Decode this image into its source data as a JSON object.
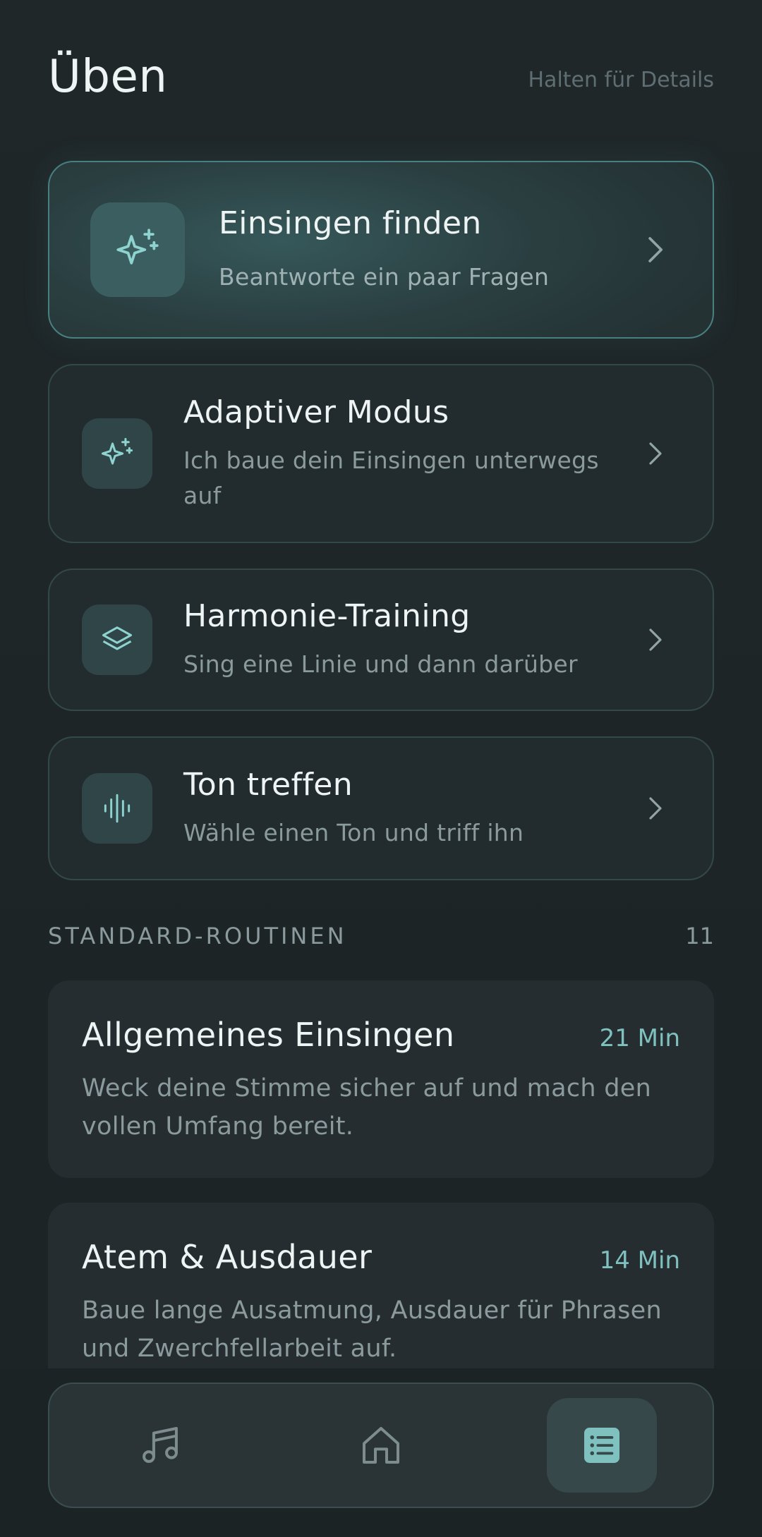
{
  "header": {
    "title": "Üben",
    "hint": "Halten für Details"
  },
  "cards": [
    {
      "title": "Einsingen finden",
      "subtitle": "Beantworte ein paar Fragen",
      "icon": "sparkles-icon",
      "featured": true
    },
    {
      "title": "Adaptiver Modus",
      "subtitle": "Ich baue dein Einsingen unterwegs auf",
      "icon": "sparkles-icon"
    },
    {
      "title": "Harmonie-Training",
      "subtitle": "Sing eine Linie und dann darüber",
      "icon": "layers-icon"
    },
    {
      "title": "Ton treffen",
      "subtitle": "Wähle einen Ton und triff ihn",
      "icon": "waveform-icon"
    }
  ],
  "routines_section": {
    "label": "STANDARD-ROUTINEN",
    "count": "11"
  },
  "routines": [
    {
      "title": "Allgemeines Einsingen",
      "duration": "21 Min",
      "description": "Weck deine Stimme sicher auf und mach den vollen Umfang bereit."
    },
    {
      "title": "Atem & Ausdauer",
      "duration": "14 Min",
      "description": "Baue lange Ausatmung, Ausdauer für Phrasen und Zwerchfellarbeit auf."
    }
  ],
  "nav": {
    "items": [
      {
        "icon": "music-note-icon",
        "active": false
      },
      {
        "icon": "home-icon",
        "active": false
      },
      {
        "icon": "list-icon",
        "active": true
      }
    ]
  },
  "colors": {
    "background": "#1d2527",
    "accent": "#7fc1bf",
    "featured_border": "#4a7f80"
  }
}
